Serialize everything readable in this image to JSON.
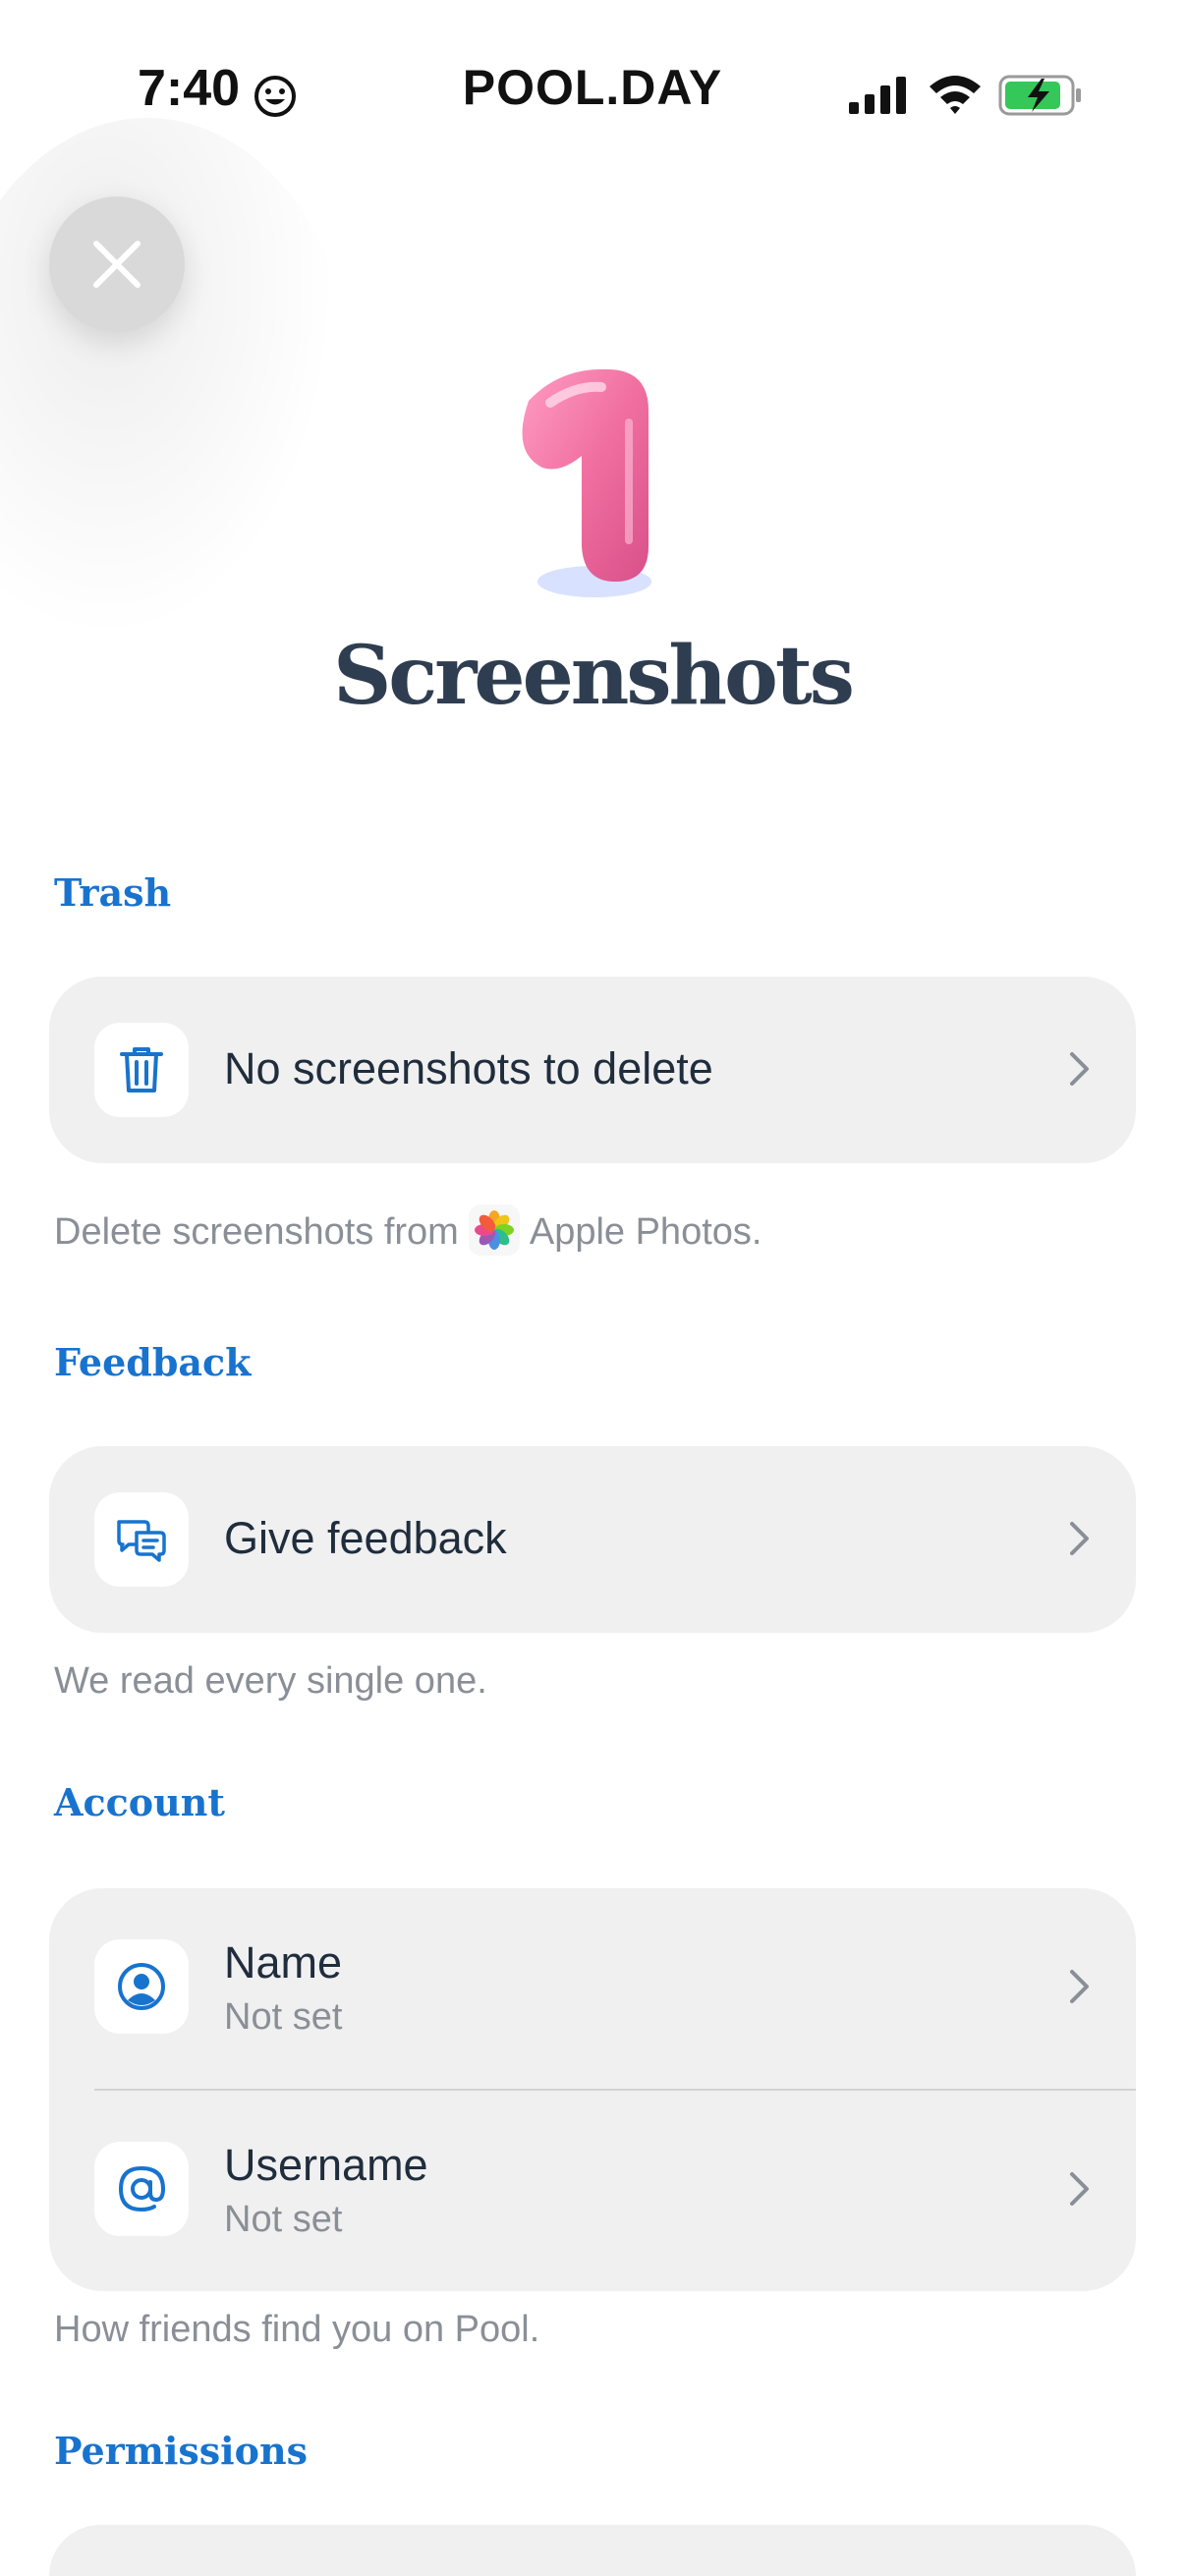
{
  "status_bar": {
    "time": "7:40",
    "carrier": "POOL.DAY"
  },
  "hero": {
    "count": "1",
    "title": "Screenshots"
  },
  "sections": {
    "trash": {
      "label": "Trash",
      "row_title": "No screenshots to delete",
      "caption_before": "Delete screenshots from",
      "caption_after": "Apple Photos."
    },
    "feedback": {
      "label": "Feedback",
      "row_title": "Give feedback",
      "caption": "We read every single one."
    },
    "account": {
      "label": "Account",
      "name_title": "Name",
      "name_value": "Not set",
      "username_title": "Username",
      "username_value": "Not set",
      "caption": "How friends find you on Pool."
    },
    "permissions": {
      "label": "Permissions"
    }
  },
  "colors": {
    "accent": "#1873cf",
    "card": "#f0f0f0",
    "hero_pink": "#f06fa0"
  },
  "icons": [
    "smiley-icon",
    "signal-icon",
    "wifi-icon",
    "battery-charging-icon",
    "close-icon",
    "trash-icon",
    "feedback-bubbles-icon",
    "user-circle-icon",
    "at-sign-icon",
    "chevron-right-icon",
    "photos-app-icon"
  ]
}
